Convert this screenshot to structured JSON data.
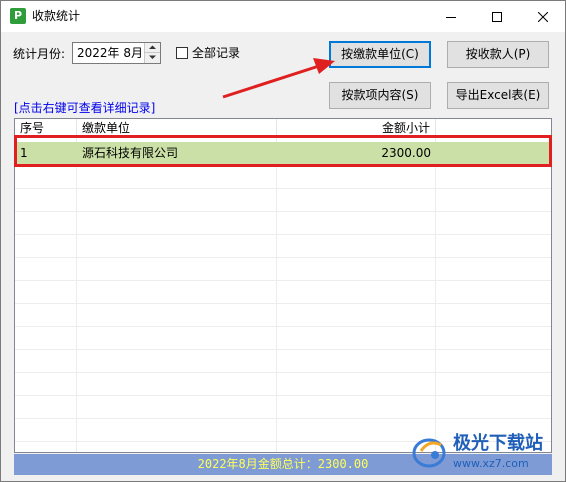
{
  "window": {
    "title": "收款统计",
    "icon_letter": "P",
    "controls": [
      "minimize-icon",
      "maximize-icon",
      "close-icon"
    ]
  },
  "filter": {
    "month_label": "统计月份:",
    "month_value": "2022年  8月",
    "all_records_label": "全部记录",
    "all_records_checked": false
  },
  "buttons": {
    "by_payer_unit": "按缴款单位(C)",
    "by_payer": "按收款人(P)",
    "by_item_content": "按款项内容(S)",
    "export_excel": "导出Excel表(E)"
  },
  "hint": "[点击右键可查看详细记录]",
  "table": {
    "columns": [
      "序号",
      "缴款单位",
      "金额小计"
    ],
    "rows": [
      {
        "index": "1",
        "unit": "源石科技有限公司",
        "amount": "2300.00"
      }
    ]
  },
  "total": "2022年8月金额总计：2300.00",
  "colors": {
    "selected_row": "#cbe0a6",
    "highlight_box": "#e02020",
    "total_bar": "#7f9bd6",
    "total_text": "#ffff55",
    "hint_text": "#0000ee"
  },
  "watermark": {
    "title": "极光下载站",
    "url": "www.xz7.com"
  }
}
